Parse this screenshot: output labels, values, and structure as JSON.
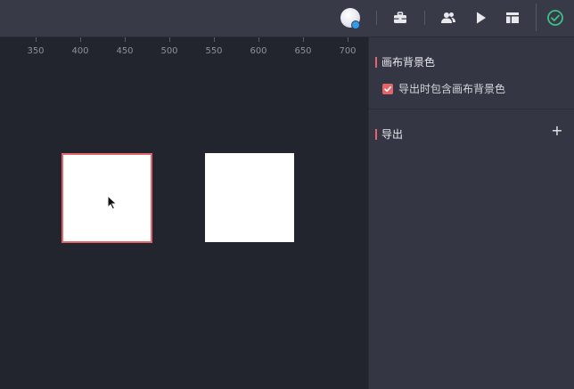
{
  "toolbar": {
    "icons": [
      "avatar",
      "toolbox-icon",
      "users-icon",
      "play-icon",
      "layout-icon",
      "check-circle-icon"
    ],
    "accent_color": "#e4646b",
    "success_color": "#3cc08a"
  },
  "ruler": {
    "ticks": [
      "350",
      "400",
      "450",
      "500",
      "550",
      "600",
      "650",
      "700"
    ]
  },
  "panel": {
    "background_section": {
      "title": "画布背景色",
      "checkbox_label": "导出时包含画布背景色",
      "checked": true
    },
    "export_section": {
      "title": "导出",
      "add_label": "+"
    }
  }
}
